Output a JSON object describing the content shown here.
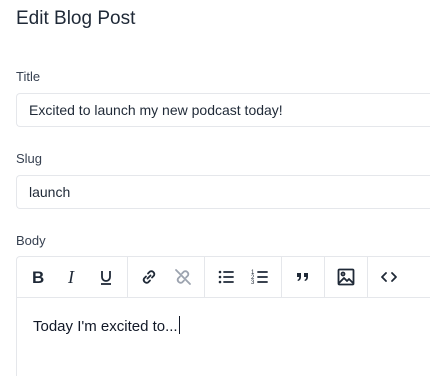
{
  "page": {
    "title": "Edit Blog Post"
  },
  "fields": {
    "title": {
      "label": "Title",
      "value": "Excited to launch my new podcast today!"
    },
    "slug": {
      "label": "Slug",
      "value": "launch"
    },
    "body": {
      "label": "Body",
      "content": "Today I'm excited to..."
    }
  },
  "toolbar": {
    "buttons": [
      {
        "name": "bold",
        "icon": "bold-icon"
      },
      {
        "name": "italic",
        "icon": "italic-icon"
      },
      {
        "name": "underline",
        "icon": "underline-icon"
      },
      {
        "name": "link",
        "icon": "link-icon"
      },
      {
        "name": "unlink",
        "icon": "unlink-icon"
      },
      {
        "name": "bulleted-list",
        "icon": "bulleted-list-icon"
      },
      {
        "name": "numbered-list",
        "icon": "numbered-list-icon"
      },
      {
        "name": "blockquote",
        "icon": "quote-icon"
      },
      {
        "name": "image",
        "icon": "image-icon"
      },
      {
        "name": "code",
        "icon": "code-icon"
      }
    ]
  }
}
